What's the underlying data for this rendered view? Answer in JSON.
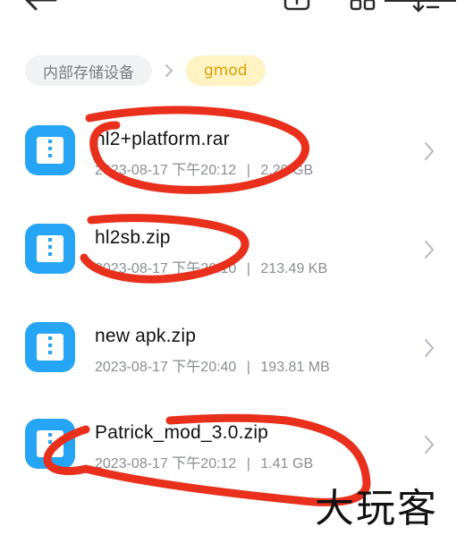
{
  "breadcrumb": {
    "root": "内部存储设备",
    "current": "gmod"
  },
  "files": [
    {
      "name": "hl2+platform.rar",
      "date": "2023-08-17 下午20:12",
      "size": "2.20 GB"
    },
    {
      "name": "hl2sb.zip",
      "date": "2023-08-17 下午20:10",
      "size": "213.49 KB"
    },
    {
      "name": "new apk.zip",
      "date": "2023-08-17 下午20:40",
      "size": "193.81 MB"
    },
    {
      "name": "Patrick_mod_3.0.zip",
      "date": "2023-08-17 下午20:12",
      "size": "1.41 GB"
    }
  ],
  "meta_separator": "|",
  "watermark": "大玩客",
  "colors": {
    "file_icon": "#27a5f5",
    "current_chip_bg": "#fff3c4",
    "current_chip_text": "#d9a200",
    "scribble": "#e8301c"
  }
}
